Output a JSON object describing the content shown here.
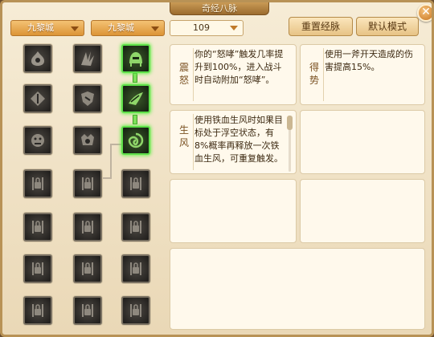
{
  "window": {
    "title": "奇经八脉",
    "close_label": "✕"
  },
  "toolbar": {
    "school_select_1": "九黎城",
    "school_select_2": "九黎城",
    "level_select": "109",
    "reset_button": "重置经脉",
    "default_button": "默认模式"
  },
  "meridian_grid": {
    "rows": 7,
    "cols": 3,
    "active_slots": [
      "row1-col3",
      "row2-col3",
      "row3-col3"
    ]
  },
  "cards": {
    "zhennu": {
      "label": "震怒",
      "text": "你的“怒哮”触发几率提升到100%，进入战斗时自动附加“怒哮”。"
    },
    "deshi": {
      "label": "得势",
      "text": "使用一斧开天造成的伤害提高15%。"
    },
    "shengfeng": {
      "label": "生风",
      "text": "使用铁血生风时如果目标处于浮空状态，有8%概率再释放一次铁血生风，可重复触发。"
    }
  },
  "colors": {
    "accent": "#e39a3a",
    "active_border": "#5fe04a",
    "panel_bg": "#f3e7cf"
  }
}
